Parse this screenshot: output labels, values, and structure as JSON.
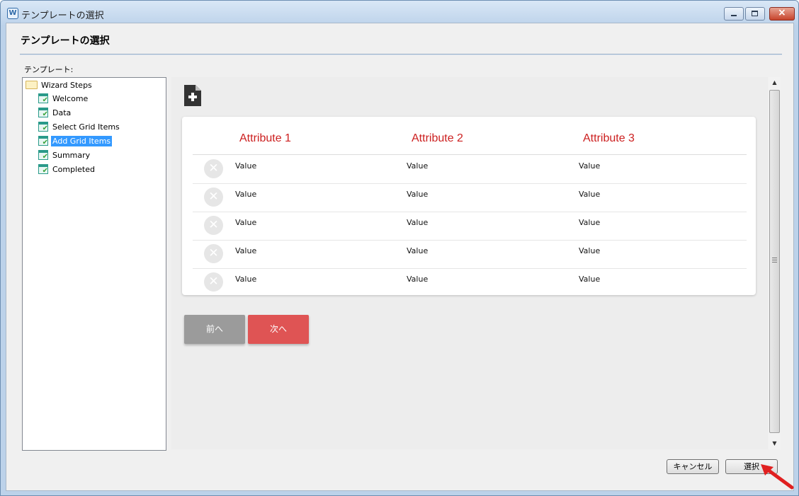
{
  "window": {
    "title": "テンプレートの選択",
    "app_icon_glyph": "W"
  },
  "dialog": {
    "title": "テンプレートの選択",
    "tree_label": "テンプレート:"
  },
  "tree": {
    "root": "Wizard Steps",
    "items": [
      {
        "label": "Welcome",
        "selected": false
      },
      {
        "label": "Data",
        "selected": false
      },
      {
        "label": "Select Grid Items",
        "selected": false
      },
      {
        "label": "Add Grid Items",
        "selected": true
      },
      {
        "label": "Summary",
        "selected": false
      },
      {
        "label": "Completed",
        "selected": false
      }
    ]
  },
  "grid": {
    "headers": [
      "Attribute 1",
      "Attribute 2",
      "Attribute 3"
    ],
    "rows": [
      [
        "Value",
        "Value",
        "Value"
      ],
      [
        "Value",
        "Value",
        "Value"
      ],
      [
        "Value",
        "Value",
        "Value"
      ],
      [
        "Value",
        "Value",
        "Value"
      ],
      [
        "Value",
        "Value",
        "Value"
      ]
    ],
    "header_color": "#cc1f1f"
  },
  "nav": {
    "prev_label": "前へ",
    "next_label": "次へ"
  },
  "footer": {
    "cancel_label": "キャンセル",
    "select_label": "選択"
  },
  "icons": {
    "add_document": "document-add-icon",
    "row_delete": "delete-x-icon",
    "folder": "folder-icon",
    "step": "step-check-icon"
  },
  "colors": {
    "accent": "#df5454",
    "prev_button": "#9b9b9b",
    "selection": "#3399ff",
    "annotation_arrow": "#e02020"
  }
}
